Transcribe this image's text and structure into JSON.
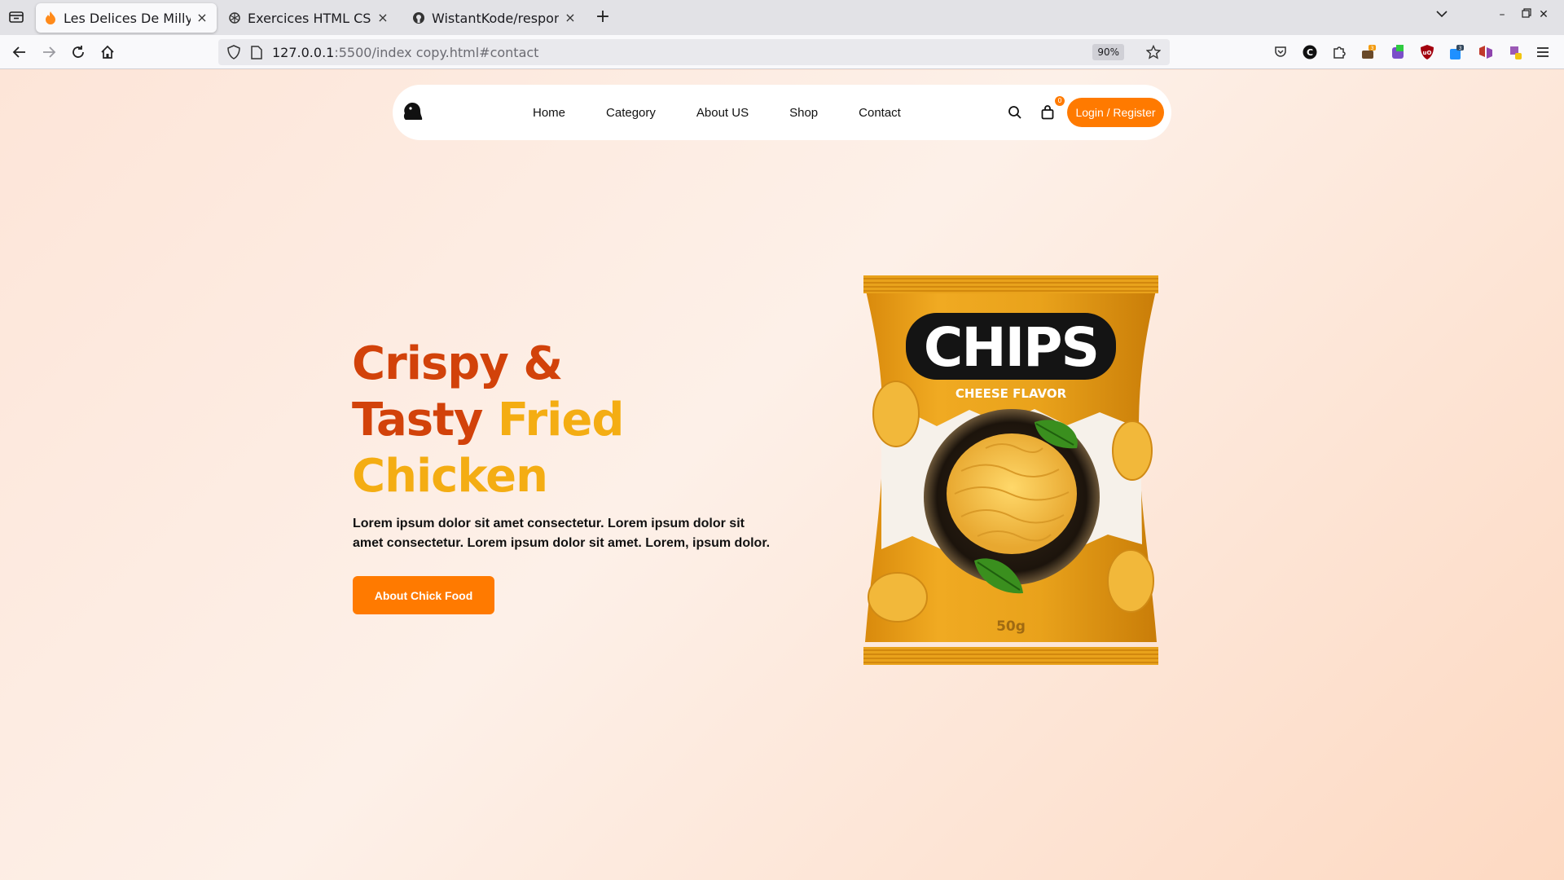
{
  "browser": {
    "tabs": [
      {
        "title": "Les Delices De Milly",
        "icon": "flame-favicon",
        "active": true
      },
      {
        "title": "Exercices HTML CSS JS",
        "icon": "openai-favicon",
        "active": false
      },
      {
        "title": "WistantKode/responsive",
        "icon": "github-favicon",
        "active": false
      }
    ],
    "url_host": "127.0.0.1",
    "url_path": ":5500/index copy.html#contact",
    "zoom": "90%",
    "extension_badges": {
      "ext_a": "3",
      "ext_b": "3"
    }
  },
  "site": {
    "logo": "chick-logo-icon",
    "nav": [
      "Home",
      "Category",
      "About US",
      "Shop",
      "Contact"
    ],
    "cart_count": "0",
    "login_label": "Login / Register",
    "hero": {
      "title_1": "Crispy &",
      "title_2a": "Tasty ",
      "title_2b": "Fried",
      "title_3": "Chicken",
      "text": "Lorem ipsum dolor sit amet consectetur. Lorem ipsum dolor sit amet consectetur. Lorem ipsum dolor sit amet. Lorem, ipsum dolor.",
      "cta": "About Chick Food"
    },
    "product": {
      "brand": "CHIPS",
      "flavor": "CHEESE FLAVOR",
      "weight": "50g"
    }
  },
  "colors": {
    "accent": "#ff7a00",
    "title_dark": "#d2420a",
    "title_gold": "#f4ad13",
    "bag": "#e9a21b"
  }
}
